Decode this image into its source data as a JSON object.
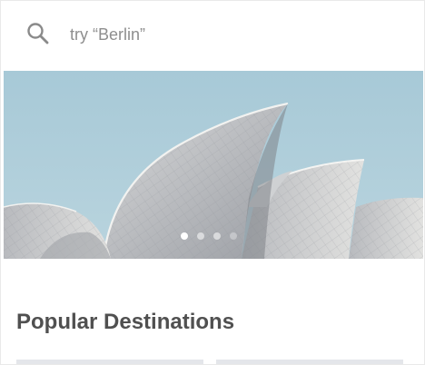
{
  "search": {
    "placeholder": "try “Berlin”",
    "value": "",
    "icon": "search-icon"
  },
  "carousel": {
    "image_subject": "Sydney Opera House",
    "slide_count": 4,
    "active_index": 0,
    "colors": {
      "sky": "#a9cad8",
      "shell": "#c9cbce"
    }
  },
  "popular": {
    "title": "Popular Destinations"
  }
}
